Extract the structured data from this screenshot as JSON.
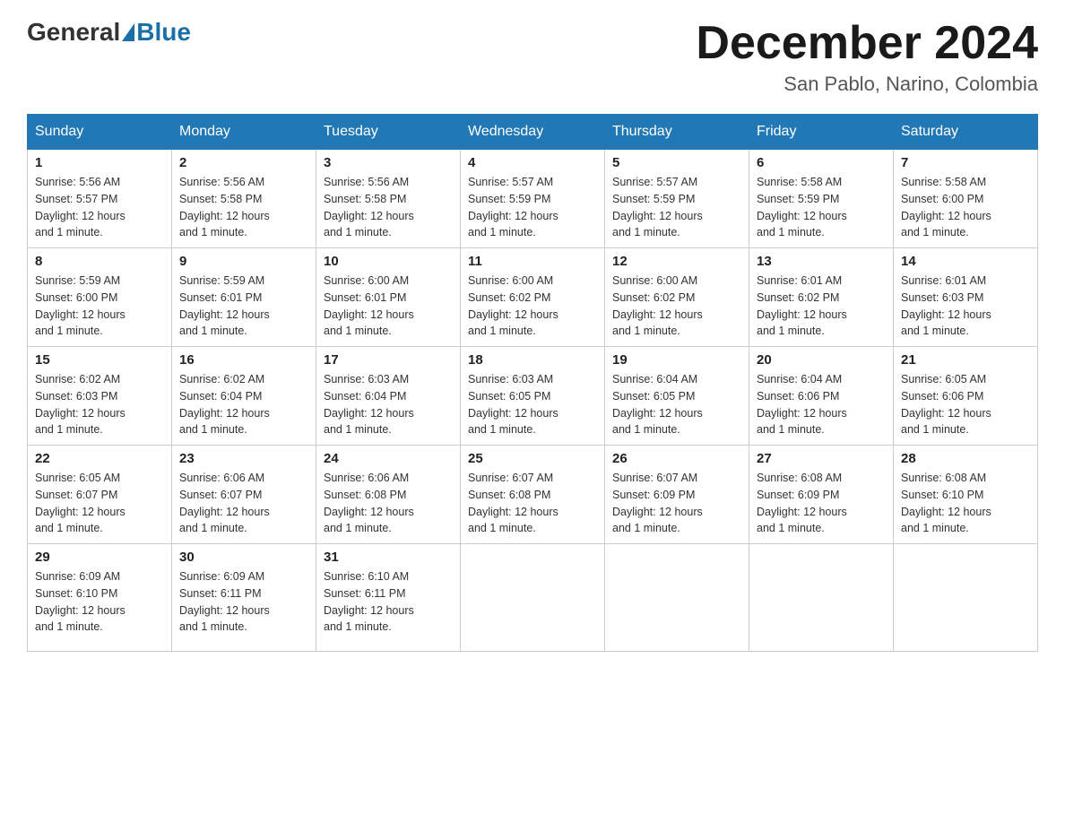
{
  "header": {
    "logo_general": "General",
    "logo_blue": "Blue",
    "month_title": "December 2024",
    "location": "San Pablo, Narino, Colombia"
  },
  "weekdays": [
    "Sunday",
    "Monday",
    "Tuesday",
    "Wednesday",
    "Thursday",
    "Friday",
    "Saturday"
  ],
  "weeks": [
    [
      {
        "day": "1",
        "sunrise": "5:56 AM",
        "sunset": "5:57 PM",
        "daylight": "12 hours and 1 minute."
      },
      {
        "day": "2",
        "sunrise": "5:56 AM",
        "sunset": "5:58 PM",
        "daylight": "12 hours and 1 minute."
      },
      {
        "day": "3",
        "sunrise": "5:56 AM",
        "sunset": "5:58 PM",
        "daylight": "12 hours and 1 minute."
      },
      {
        "day": "4",
        "sunrise": "5:57 AM",
        "sunset": "5:59 PM",
        "daylight": "12 hours and 1 minute."
      },
      {
        "day": "5",
        "sunrise": "5:57 AM",
        "sunset": "5:59 PM",
        "daylight": "12 hours and 1 minute."
      },
      {
        "day": "6",
        "sunrise": "5:58 AM",
        "sunset": "5:59 PM",
        "daylight": "12 hours and 1 minute."
      },
      {
        "day": "7",
        "sunrise": "5:58 AM",
        "sunset": "6:00 PM",
        "daylight": "12 hours and 1 minute."
      }
    ],
    [
      {
        "day": "8",
        "sunrise": "5:59 AM",
        "sunset": "6:00 PM",
        "daylight": "12 hours and 1 minute."
      },
      {
        "day": "9",
        "sunrise": "5:59 AM",
        "sunset": "6:01 PM",
        "daylight": "12 hours and 1 minute."
      },
      {
        "day": "10",
        "sunrise": "6:00 AM",
        "sunset": "6:01 PM",
        "daylight": "12 hours and 1 minute."
      },
      {
        "day": "11",
        "sunrise": "6:00 AM",
        "sunset": "6:02 PM",
        "daylight": "12 hours and 1 minute."
      },
      {
        "day": "12",
        "sunrise": "6:00 AM",
        "sunset": "6:02 PM",
        "daylight": "12 hours and 1 minute."
      },
      {
        "day": "13",
        "sunrise": "6:01 AM",
        "sunset": "6:02 PM",
        "daylight": "12 hours and 1 minute."
      },
      {
        "day": "14",
        "sunrise": "6:01 AM",
        "sunset": "6:03 PM",
        "daylight": "12 hours and 1 minute."
      }
    ],
    [
      {
        "day": "15",
        "sunrise": "6:02 AM",
        "sunset": "6:03 PM",
        "daylight": "12 hours and 1 minute."
      },
      {
        "day": "16",
        "sunrise": "6:02 AM",
        "sunset": "6:04 PM",
        "daylight": "12 hours and 1 minute."
      },
      {
        "day": "17",
        "sunrise": "6:03 AM",
        "sunset": "6:04 PM",
        "daylight": "12 hours and 1 minute."
      },
      {
        "day": "18",
        "sunrise": "6:03 AM",
        "sunset": "6:05 PM",
        "daylight": "12 hours and 1 minute."
      },
      {
        "day": "19",
        "sunrise": "6:04 AM",
        "sunset": "6:05 PM",
        "daylight": "12 hours and 1 minute."
      },
      {
        "day": "20",
        "sunrise": "6:04 AM",
        "sunset": "6:06 PM",
        "daylight": "12 hours and 1 minute."
      },
      {
        "day": "21",
        "sunrise": "6:05 AM",
        "sunset": "6:06 PM",
        "daylight": "12 hours and 1 minute."
      }
    ],
    [
      {
        "day": "22",
        "sunrise": "6:05 AM",
        "sunset": "6:07 PM",
        "daylight": "12 hours and 1 minute."
      },
      {
        "day": "23",
        "sunrise": "6:06 AM",
        "sunset": "6:07 PM",
        "daylight": "12 hours and 1 minute."
      },
      {
        "day": "24",
        "sunrise": "6:06 AM",
        "sunset": "6:08 PM",
        "daylight": "12 hours and 1 minute."
      },
      {
        "day": "25",
        "sunrise": "6:07 AM",
        "sunset": "6:08 PM",
        "daylight": "12 hours and 1 minute."
      },
      {
        "day": "26",
        "sunrise": "6:07 AM",
        "sunset": "6:09 PM",
        "daylight": "12 hours and 1 minute."
      },
      {
        "day": "27",
        "sunrise": "6:08 AM",
        "sunset": "6:09 PM",
        "daylight": "12 hours and 1 minute."
      },
      {
        "day": "28",
        "sunrise": "6:08 AM",
        "sunset": "6:10 PM",
        "daylight": "12 hours and 1 minute."
      }
    ],
    [
      {
        "day": "29",
        "sunrise": "6:09 AM",
        "sunset": "6:10 PM",
        "daylight": "12 hours and 1 minute."
      },
      {
        "day": "30",
        "sunrise": "6:09 AM",
        "sunset": "6:11 PM",
        "daylight": "12 hours and 1 minute."
      },
      {
        "day": "31",
        "sunrise": "6:10 AM",
        "sunset": "6:11 PM",
        "daylight": "12 hours and 1 minute."
      },
      null,
      null,
      null,
      null
    ]
  ],
  "labels": {
    "sunrise": "Sunrise:",
    "sunset": "Sunset:",
    "daylight": "Daylight: 12 hours"
  }
}
